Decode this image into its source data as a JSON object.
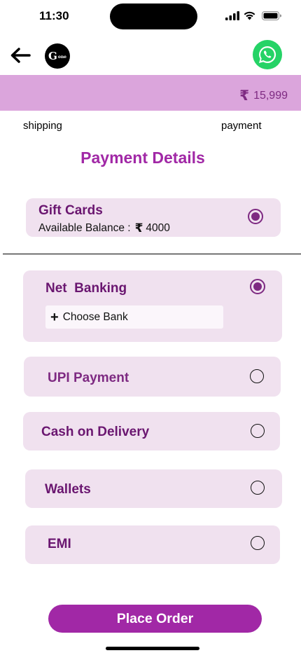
{
  "status_bar": {
    "time": "11:30"
  },
  "header": {
    "logo_text": "G",
    "logo_subtext": "one"
  },
  "price_bar": {
    "currency_symbol": "₹",
    "amount": "15,999"
  },
  "steps": {
    "shipping": "shipping",
    "payment": "payment"
  },
  "page_title": "Payment Details",
  "gift_cards": {
    "title": "Gift Cards",
    "balance_label": "Available Balance :",
    "currency_symbol": "₹",
    "balance_amount": "4000",
    "selected": true
  },
  "payment_methods": [
    {
      "label": "Net  Banking",
      "selected": true,
      "action_label": "Choose Bank",
      "action_icon": "+"
    },
    {
      "label": "UPI Payment",
      "selected": false
    },
    {
      "label": "Cash on Delivery",
      "selected": false
    },
    {
      "label": "Wallets",
      "selected": false
    },
    {
      "label": "EMI",
      "selected": false
    }
  ],
  "place_order_label": "Place Order",
  "colors": {
    "accent": "#a128a6",
    "price_bar": "#dba5dc",
    "card_bg": "#f0e1ef",
    "title_dark": "#6a1670",
    "whatsapp_green": "#25d366"
  },
  "icons": [
    "back-arrow-icon",
    "logo",
    "whatsapp-icon",
    "rupee-icon",
    "plus-icon",
    "signal-icon",
    "wifi-icon",
    "battery-icon"
  ]
}
